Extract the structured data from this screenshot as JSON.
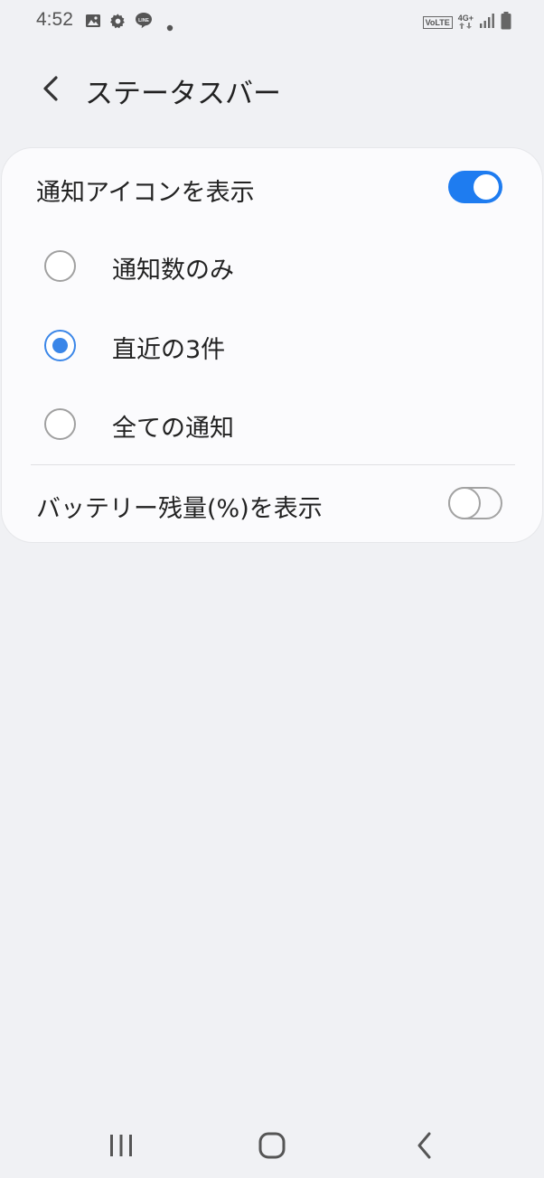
{
  "status_bar": {
    "time": "4:52",
    "left_icons": [
      "gallery-icon",
      "settings-gear-icon",
      "line-app-icon",
      "notification-dot-icon"
    ],
    "line_label": "LINE",
    "volte": "VoLTE",
    "network": "4G+",
    "right_icons": [
      "volte-icon",
      "network-4g-icon",
      "signal-icon",
      "battery-icon"
    ]
  },
  "header": {
    "title": "ステータスバー",
    "back_icon": "chevron-left-icon"
  },
  "settings": {
    "notification_icons": {
      "label": "通知アイコンを表示",
      "enabled": true
    },
    "options": [
      {
        "label": "通知数のみ",
        "selected": false
      },
      {
        "label": "直近の3件",
        "selected": true
      },
      {
        "label": "全ての通知",
        "selected": false
      }
    ],
    "battery_percent": {
      "label": "バッテリー残量(%)を表示",
      "enabled": false
    }
  },
  "nav_bar": {
    "buttons": [
      "recent-apps-icon",
      "home-icon",
      "back-icon"
    ]
  },
  "colors": {
    "accent": "#1e7cf0",
    "radio_accent": "#3a86e8",
    "background": "#f0f1f4",
    "card": "#fbfbfd"
  }
}
